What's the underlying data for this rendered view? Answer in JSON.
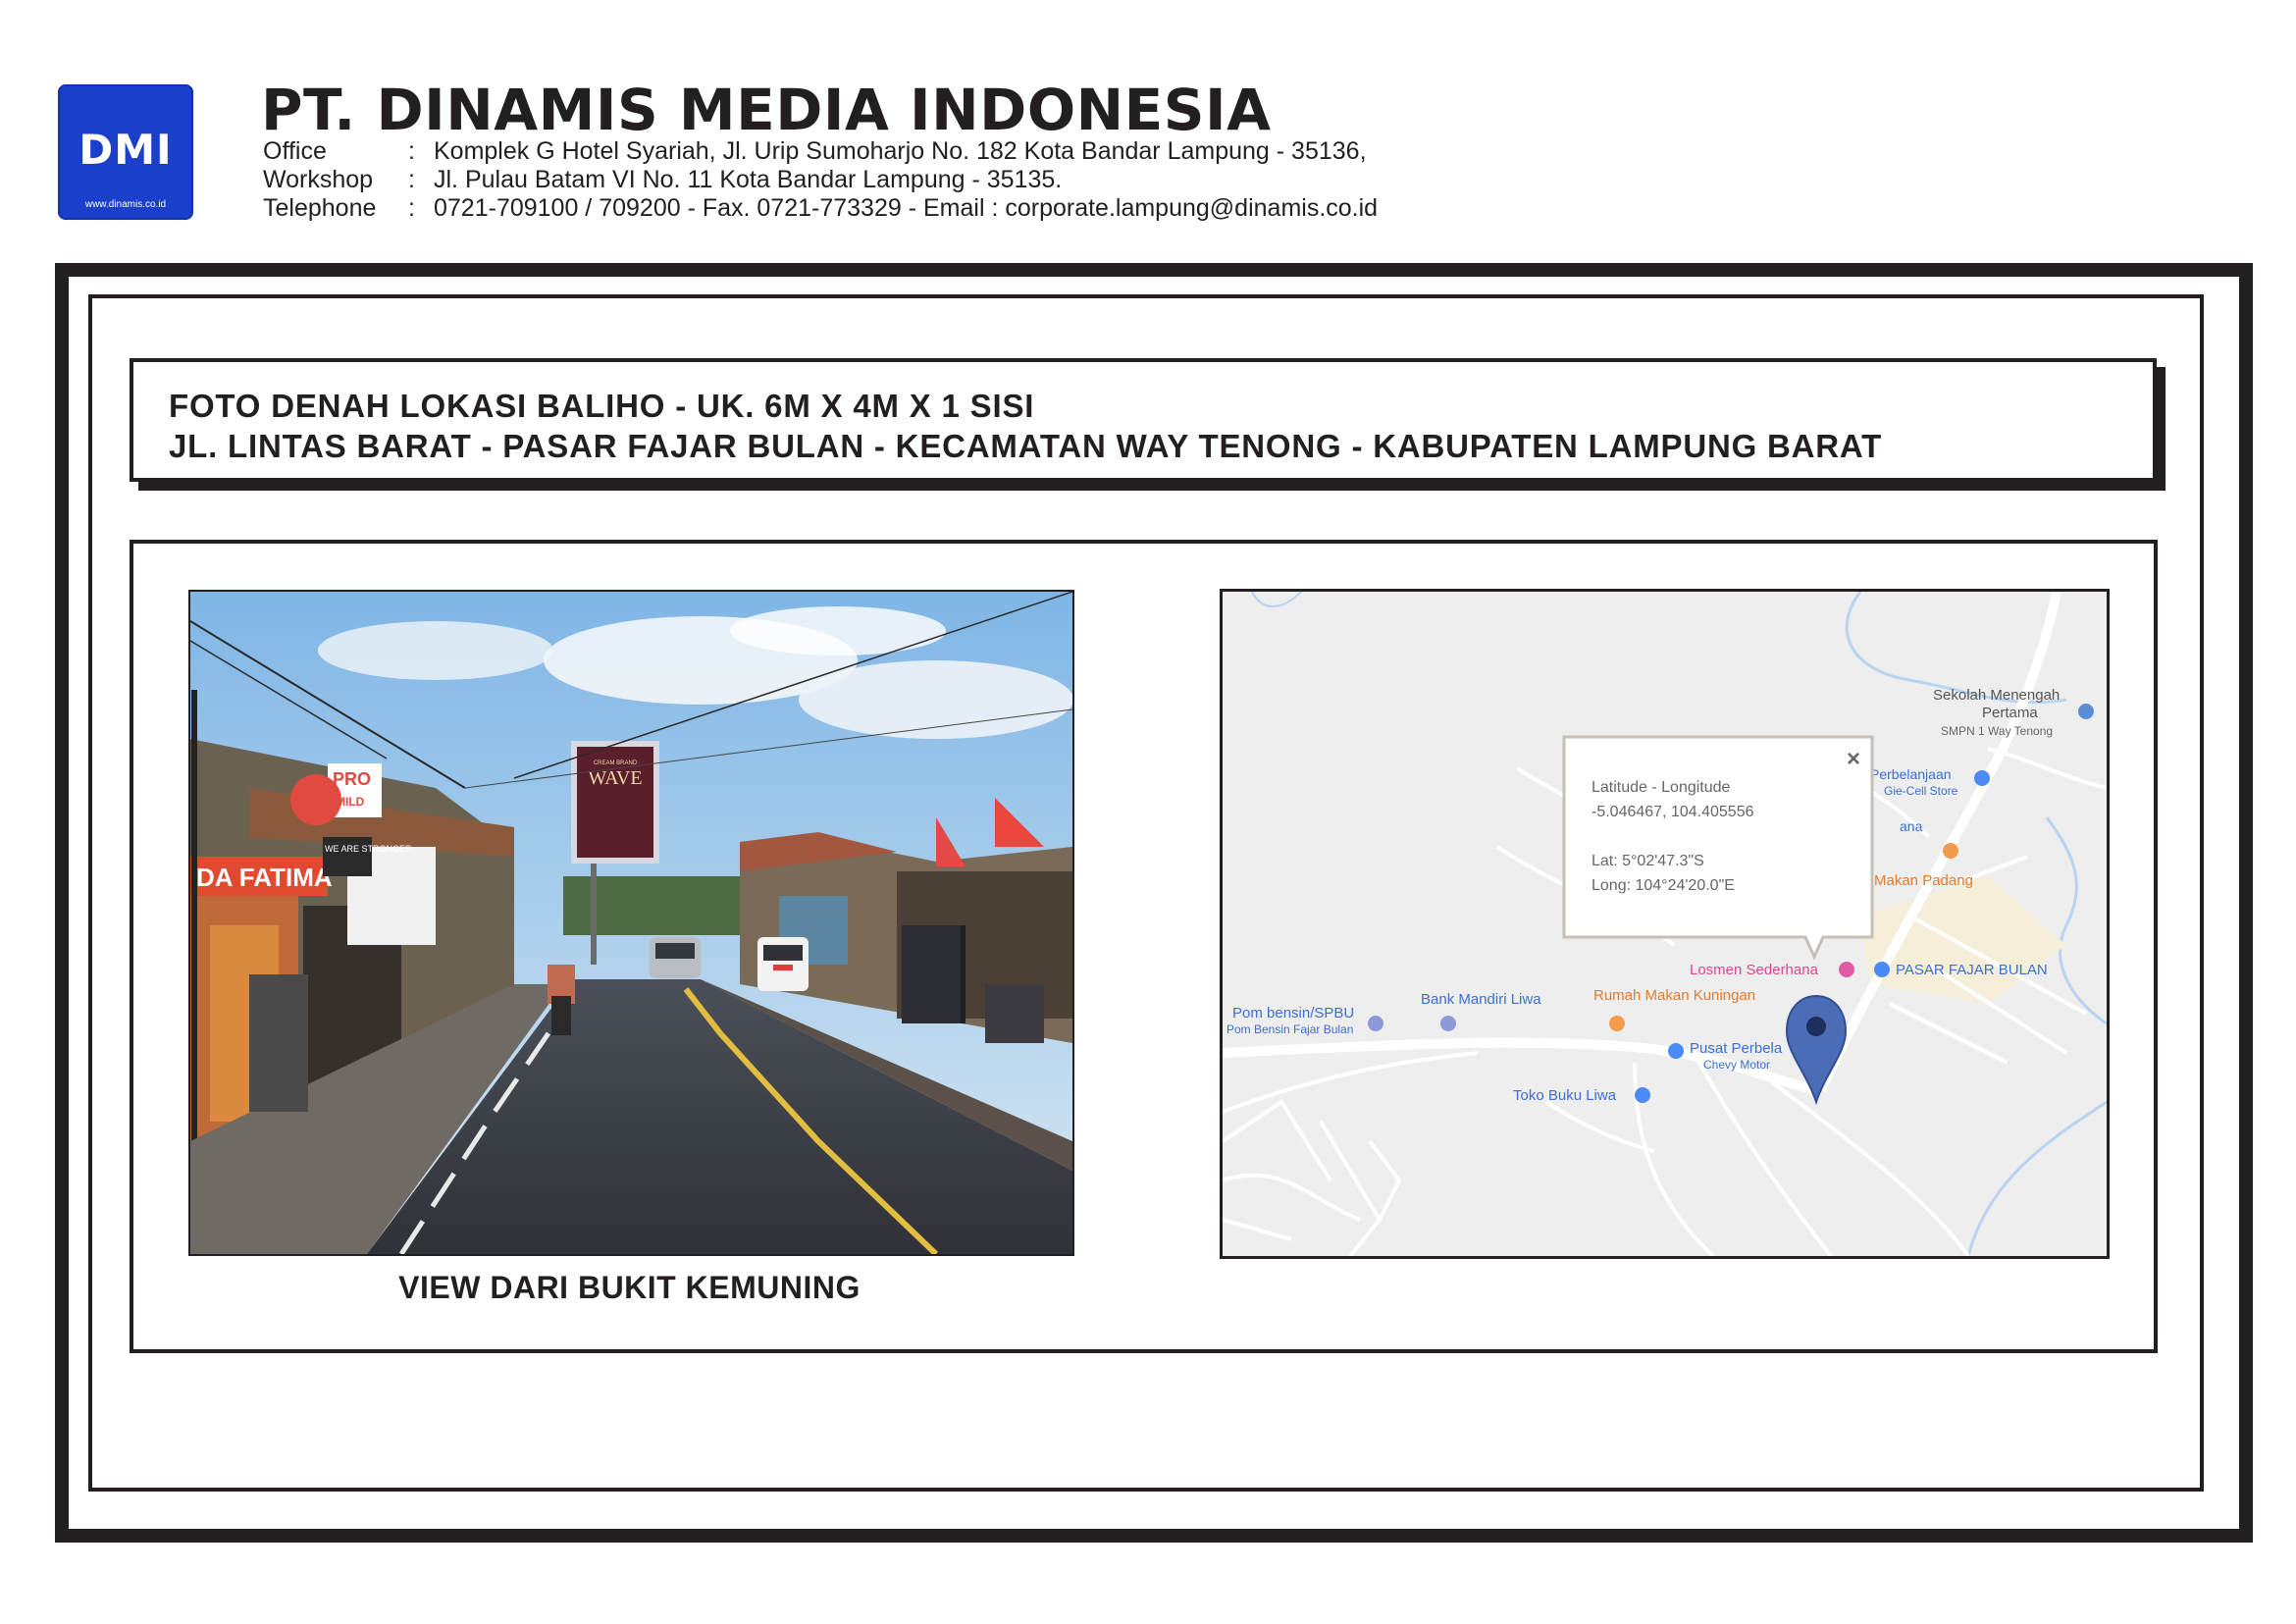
{
  "header": {
    "logo_text": "DMI",
    "logo_url": "www.dinamis.co.id",
    "company": "PT. DINAMIS MEDIA INDONESIA",
    "contacts": [
      {
        "label": "Office",
        "sep": ":",
        "value": "Komplek G Hotel Syariah, Jl. Urip  Sumoharjo No. 182 Kota Bandar Lampung - 35136,"
      },
      {
        "label": "Workshop",
        "sep": ":",
        "value": "Jl. Pulau Batam  VI  No. 11 Kota Bandar Lampung - 35135."
      },
      {
        "label": "Telephone",
        "sep": ":",
        "value": "0721-709100 / 709200 - Fax. 0721-773329 - Email : corporate.lampung@dinamis.co.id"
      }
    ]
  },
  "title": {
    "line1": "FOTO DENAH LOKASI BALIHO - UK. 6M X 4M X 1 SISI",
    "line2": "JL. LINTAS BARAT - PASAR FAJAR BULAN - KECAMATAN WAY TENONG - KABUPATEN LAMPUNG BARAT"
  },
  "photo": {
    "caption": "VIEW DARI BUKIT KEMUNING",
    "billboard_text": "WAVE",
    "billboard_small": "CREAM BRAND",
    "sign_pro": "PRO",
    "sign_mild": "MILD",
    "shop_sign": "DA FATIMA",
    "stronger_sign": "WE ARE STRONGER"
  },
  "map": {
    "popup": {
      "line1": "Latitude - Longitude",
      "line2": "-5.046467, 104.405556",
      "line3": "Lat: 5°02'47.3\"S",
      "line4": "Long: 104°24'20.0\"E",
      "close": "×"
    },
    "places": {
      "smk1": "Sekolah Menengah",
      "smk2": "Pertama",
      "smpn": "SMPN 1 Way Tenong",
      "perbelanjaan": "Perbelanjaan",
      "giecell": "Gie-Cell Store",
      "ana": "ana",
      "makan_padang": "Makan Padang",
      "losmen": "Losmen Sederhana",
      "pasar": "PASAR FAJAR BULAN",
      "bank": "Bank Mandiri Liwa",
      "rumah_makan": "Rumah Makan Kuningan",
      "pom1": "Pom bensin/SPBU",
      "pom2": "Pom Bensin Fajar Bulan",
      "pusat": "Pusat Perbela",
      "chevy": "Chevy Motor",
      "toko": "Toko Buku Liwa"
    },
    "colors": {
      "road": "#ffffff",
      "land": "#eeeeee",
      "water": "#a9cdf5",
      "poi_blue": "#4a8af4",
      "poi_orange": "#f29b4b",
      "poi_pink": "#e05aa5",
      "pin": "#4b6cb7"
    }
  },
  "colors": {
    "frame": "#231f20",
    "logo_bg": "#1a3fcb"
  }
}
